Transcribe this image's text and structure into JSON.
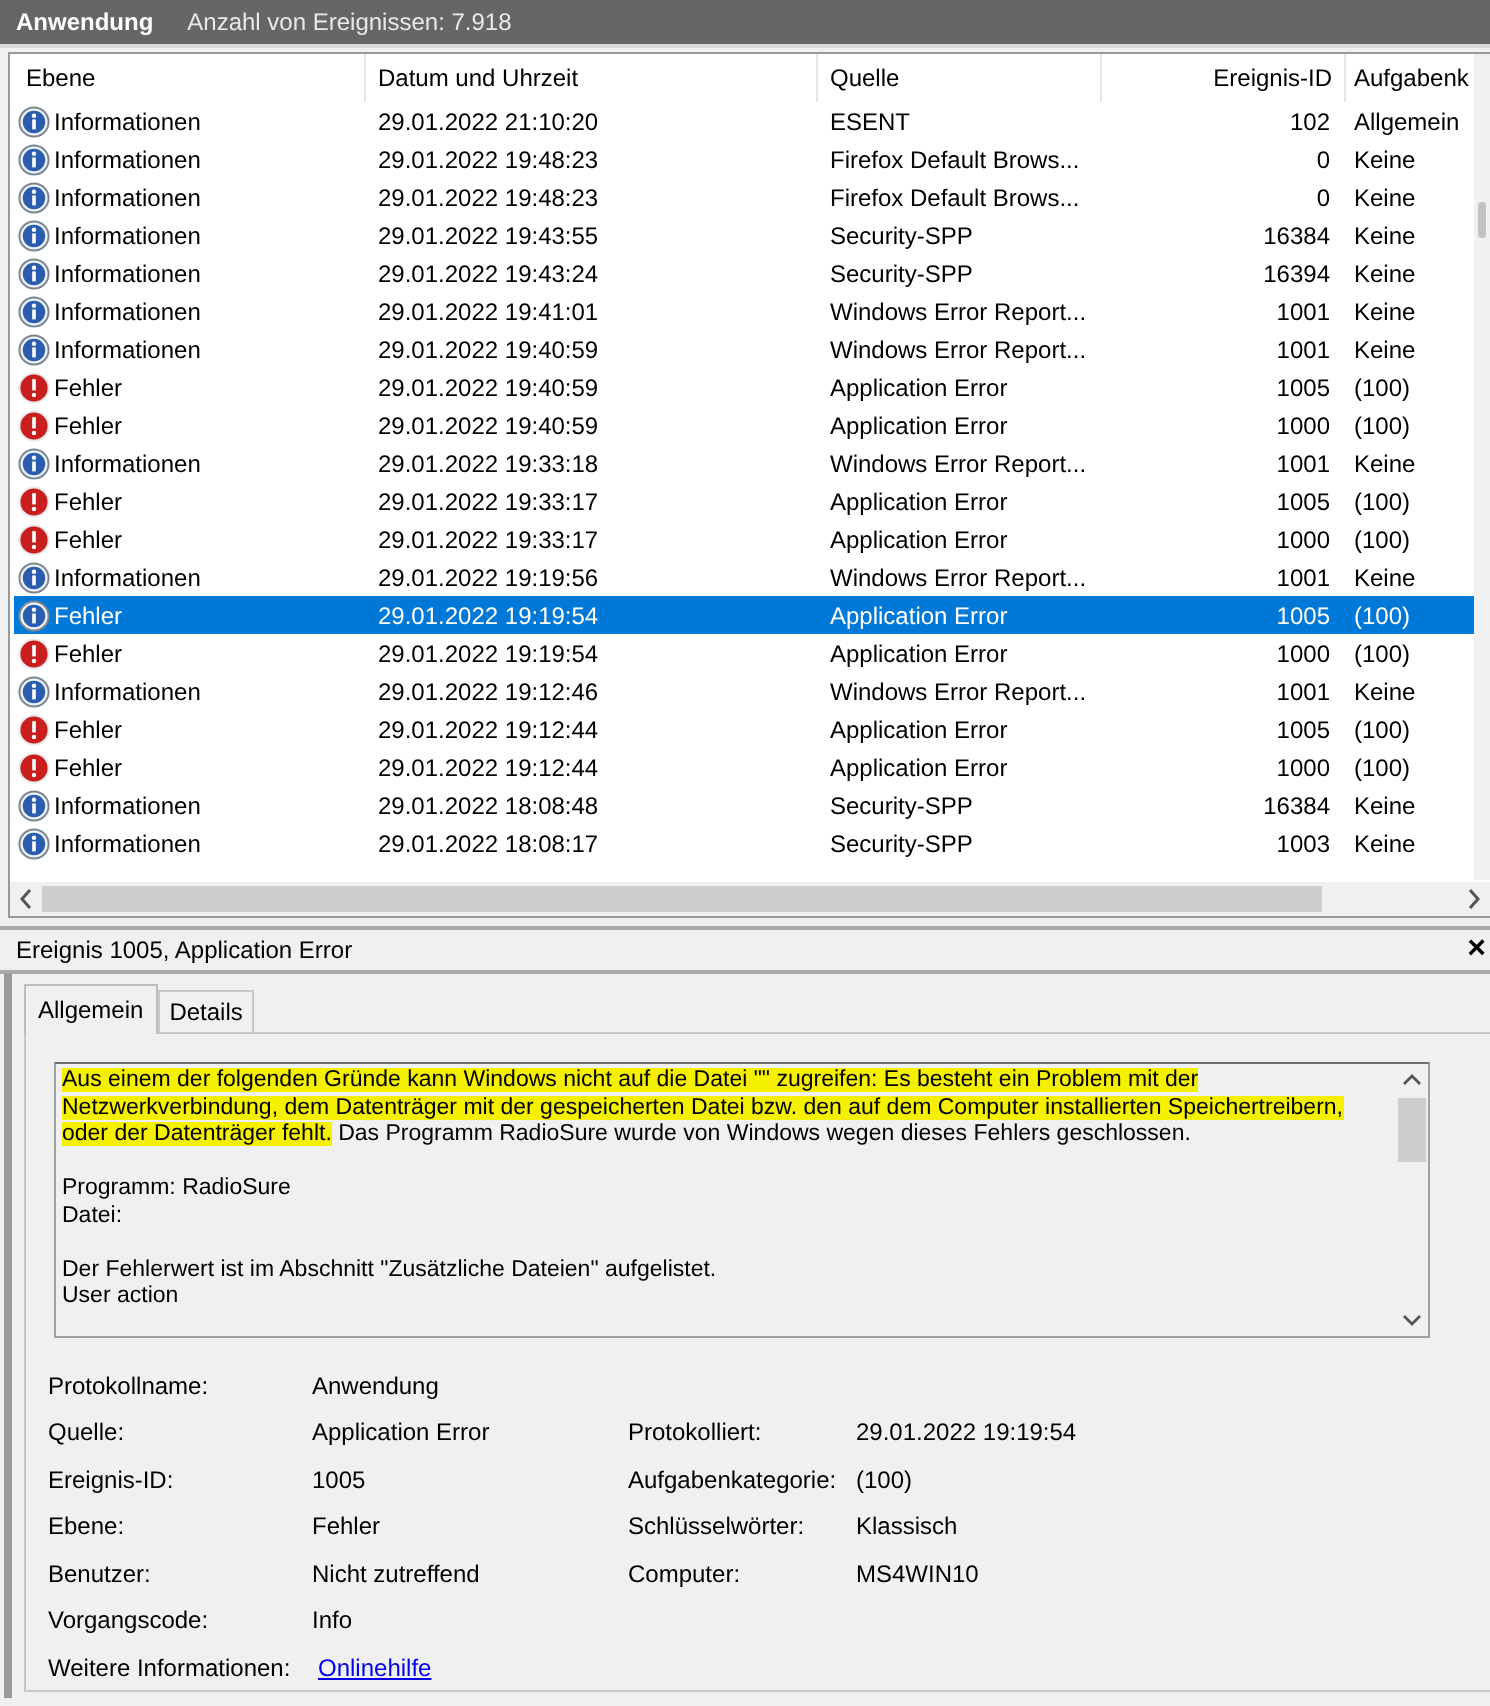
{
  "header": {
    "log_name": "Anwendung",
    "event_count": "Anzahl von Ereignissen: 7.918"
  },
  "table": {
    "columns": [
      "Ebene",
      "Datum und Uhrzeit",
      "Quelle",
      "Ereignis-ID",
      "Aufgabenk"
    ],
    "rows": [
      {
        "kind": "info",
        "level": "Informationen",
        "date": "29.01.2022 21:10:20",
        "source": "ESENT",
        "event_id": "102",
        "category": "Allgemein",
        "selected": false
      },
      {
        "kind": "info",
        "level": "Informationen",
        "date": "29.01.2022 19:48:23",
        "source": "Firefox Default Brows...",
        "event_id": "0",
        "category": "Keine",
        "selected": false
      },
      {
        "kind": "info",
        "level": "Informationen",
        "date": "29.01.2022 19:48:23",
        "source": "Firefox Default Brows...",
        "event_id": "0",
        "category": "Keine",
        "selected": false
      },
      {
        "kind": "info",
        "level": "Informationen",
        "date": "29.01.2022 19:43:55",
        "source": "Security-SPP",
        "event_id": "16384",
        "category": "Keine",
        "selected": false
      },
      {
        "kind": "info",
        "level": "Informationen",
        "date": "29.01.2022 19:43:24",
        "source": "Security-SPP",
        "event_id": "16394",
        "category": "Keine",
        "selected": false
      },
      {
        "kind": "info",
        "level": "Informationen",
        "date": "29.01.2022 19:41:01",
        "source": "Windows Error Report...",
        "event_id": "1001",
        "category": "Keine",
        "selected": false
      },
      {
        "kind": "info",
        "level": "Informationen",
        "date": "29.01.2022 19:40:59",
        "source": "Windows Error Report...",
        "event_id": "1001",
        "category": "Keine",
        "selected": false
      },
      {
        "kind": "error",
        "level": "Fehler",
        "date": "29.01.2022 19:40:59",
        "source": "Application Error",
        "event_id": "1005",
        "category": "(100)",
        "selected": false
      },
      {
        "kind": "error",
        "level": "Fehler",
        "date": "29.01.2022 19:40:59",
        "source": "Application Error",
        "event_id": "1000",
        "category": "(100)",
        "selected": false
      },
      {
        "kind": "info",
        "level": "Informationen",
        "date": "29.01.2022 19:33:18",
        "source": "Windows Error Report...",
        "event_id": "1001",
        "category": "Keine",
        "selected": false
      },
      {
        "kind": "error",
        "level": "Fehler",
        "date": "29.01.2022 19:33:17",
        "source": "Application Error",
        "event_id": "1005",
        "category": "(100)",
        "selected": false
      },
      {
        "kind": "error",
        "level": "Fehler",
        "date": "29.01.2022 19:33:17",
        "source": "Application Error",
        "event_id": "1000",
        "category": "(100)",
        "selected": false
      },
      {
        "kind": "info",
        "level": "Informationen",
        "date": "29.01.2022 19:19:56",
        "source": "Windows Error Report...",
        "event_id": "1001",
        "category": "Keine",
        "selected": false
      },
      {
        "kind": "info",
        "level": "Fehler",
        "date": "29.01.2022 19:19:54",
        "source": "Application Error",
        "event_id": "1005",
        "category": "(100)",
        "selected": true
      },
      {
        "kind": "error",
        "level": "Fehler",
        "date": "29.01.2022 19:19:54",
        "source": "Application Error",
        "event_id": "1000",
        "category": "(100)",
        "selected": false
      },
      {
        "kind": "info",
        "level": "Informationen",
        "date": "29.01.2022 19:12:46",
        "source": "Windows Error Report...",
        "event_id": "1001",
        "category": "Keine",
        "selected": false
      },
      {
        "kind": "error",
        "level": "Fehler",
        "date": "29.01.2022 19:12:44",
        "source": "Application Error",
        "event_id": "1005",
        "category": "(100)",
        "selected": false
      },
      {
        "kind": "error",
        "level": "Fehler",
        "date": "29.01.2022 19:12:44",
        "source": "Application Error",
        "event_id": "1000",
        "category": "(100)",
        "selected": false
      },
      {
        "kind": "info",
        "level": "Informationen",
        "date": "29.01.2022 18:08:48",
        "source": "Security-SPP",
        "event_id": "16384",
        "category": "Keine",
        "selected": false
      },
      {
        "kind": "info",
        "level": "Informationen",
        "date": "29.01.2022 18:08:17",
        "source": "Security-SPP",
        "event_id": "1003",
        "category": "Keine",
        "selected": false
      }
    ]
  },
  "detail": {
    "title": "Ereignis 1005, Application Error",
    "close": "×",
    "tabs": [
      {
        "label": "Allgemein",
        "selected": true
      },
      {
        "label": "Details",
        "selected": false
      }
    ],
    "description": [
      {
        "lines": [
          [
            {
              "text": "Aus einem der folgenden Gründe kann Windows nicht auf die Datei \"\" zugreifen: Es besteht ein Problem mit der Netzwerkverbindung, dem Datenträger mit der gespeicherten Datei bzw. den auf dem Computer installierten Speichertreibern, oder der Datenträger fehlt.",
              "highlighted": true
            },
            {
              "text": " Das Programm RadioSure wurde von Windows wegen dieses Fehlers geschlossen.",
              "highlighted": false
            }
          ]
        ]
      },
      {
        "lines": [
          [
            {
              "text": "Programm: RadioSure",
              "highlighted": false
            }
          ],
          [
            {
              "text": "Datei:",
              "highlighted": false
            }
          ]
        ]
      },
      {
        "lines": [
          [
            {
              "text": "Der Fehlerwert ist im Abschnitt \"Zusätzliche Dateien\" aufgelistet.",
              "highlighted": false
            }
          ],
          [
            {
              "text": "User action",
              "highlighted": false
            }
          ]
        ]
      }
    ],
    "properties": [
      [
        {
          "label": "Protokollname:",
          "value": "Anwendung",
          "kind": "text"
        }
      ],
      [
        {
          "label": "Quelle:",
          "value": "Application Error",
          "kind": "text"
        },
        {
          "label": "Protokolliert:",
          "value": "29.01.2022 19:19:54",
          "kind": "text"
        }
      ],
      [
        {
          "label": "Ereignis-ID:",
          "value": "1005",
          "kind": "text"
        },
        {
          "label": "Aufgabenkategorie:",
          "value": "(100)",
          "kind": "text"
        }
      ],
      [
        {
          "label": "Ebene:",
          "value": "Fehler",
          "kind": "text"
        },
        {
          "label": "Schlüsselwörter:",
          "value": "Klassisch",
          "kind": "text"
        }
      ],
      [
        {
          "label": "Benutzer:",
          "value": "Nicht zutreffend",
          "kind": "text"
        },
        {
          "label": "Computer:",
          "value": "MS4WIN10",
          "kind": "text"
        }
      ],
      [
        {
          "label": "Vorgangscode:",
          "value": "Info",
          "kind": "text"
        }
      ],
      [
        {
          "label": "Weitere Informationen:",
          "value": "Onlinehilfe",
          "kind": "link"
        }
      ]
    ]
  }
}
